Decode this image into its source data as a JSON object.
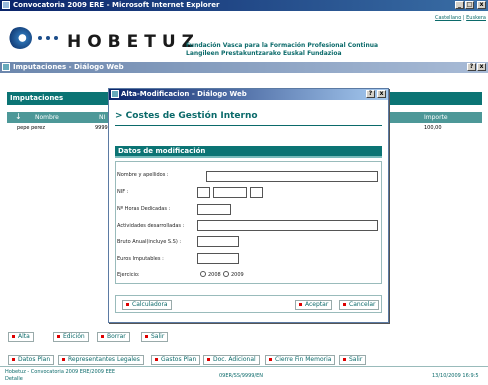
{
  "ie_window": {
    "title": "Convocatoria 2009 ERE - Microsoft Internet Explorer"
  },
  "header": {
    "links": {
      "castellano": "Castellano",
      "sep": "|",
      "euskera": "Euskera"
    },
    "logo_text": "HOBETUZ",
    "tagline_es": "Fundación Vasca para la Formación Profesional Continua",
    "tagline_eu": "Langileen Prestakuntzarako Euskal Fundazioa"
  },
  "imputaciones_dialog": {
    "title": "Imputaciones - Diálogo Web",
    "help": "?",
    "close": "x",
    "section_title": "Imputaciones",
    "columns": {
      "nombre": "Nombre",
      "ni": "NI",
      "importe": "Importe"
    },
    "rows": [
      {
        "nombre": "pepe perez",
        "ni": "9999",
        "importe": "100,00"
      }
    ],
    "sort_arrow": "↓"
  },
  "alta_dialog": {
    "title": "Alta-Modificacion - Diálogo Web",
    "help": "?",
    "close": "x",
    "heading": "> Costes de Gestión Interno",
    "section": "Datos de modificación",
    "labels": {
      "nombre": "Nombre y apellidos :",
      "nif": "NIF :",
      "horas": "Nº Horas Dedicadas :",
      "actividades": "Actividades desarrolladas :",
      "bruto": "Bruto Anual(incluye S.S) :",
      "euros": "Euros Imputables :",
      "ejercicio": "Ejercicio:"
    },
    "ejercicio_options": [
      "2008",
      "2009"
    ],
    "buttons": {
      "calculadora": "Calculadora",
      "aceptar": "Aceptar",
      "cancelar": "Cancelar"
    }
  },
  "actions": {
    "alta": "Alta",
    "edicion": "Edición",
    "borrar": "Borrar",
    "salir": "Salir"
  },
  "bottom_nav": {
    "datos_plan": "Datos Plan",
    "representantes": "Representantes Legales",
    "gastos_plan": "Gastos Plan",
    "doc_adicional": "Doc. Adicional",
    "cierre": "Cierre Fin Memoria",
    "salir": "Salir"
  },
  "status": {
    "line1": "Hobetuz - Convocatoria 2009 ERE/2009 EEE",
    "line2": "Detalle",
    "code": "09ER/SS/9999/EN",
    "datetime": "13/10/2009 16:9:5"
  },
  "colors": {
    "teal": "#0b7474",
    "title_blue": "#0a246a"
  }
}
